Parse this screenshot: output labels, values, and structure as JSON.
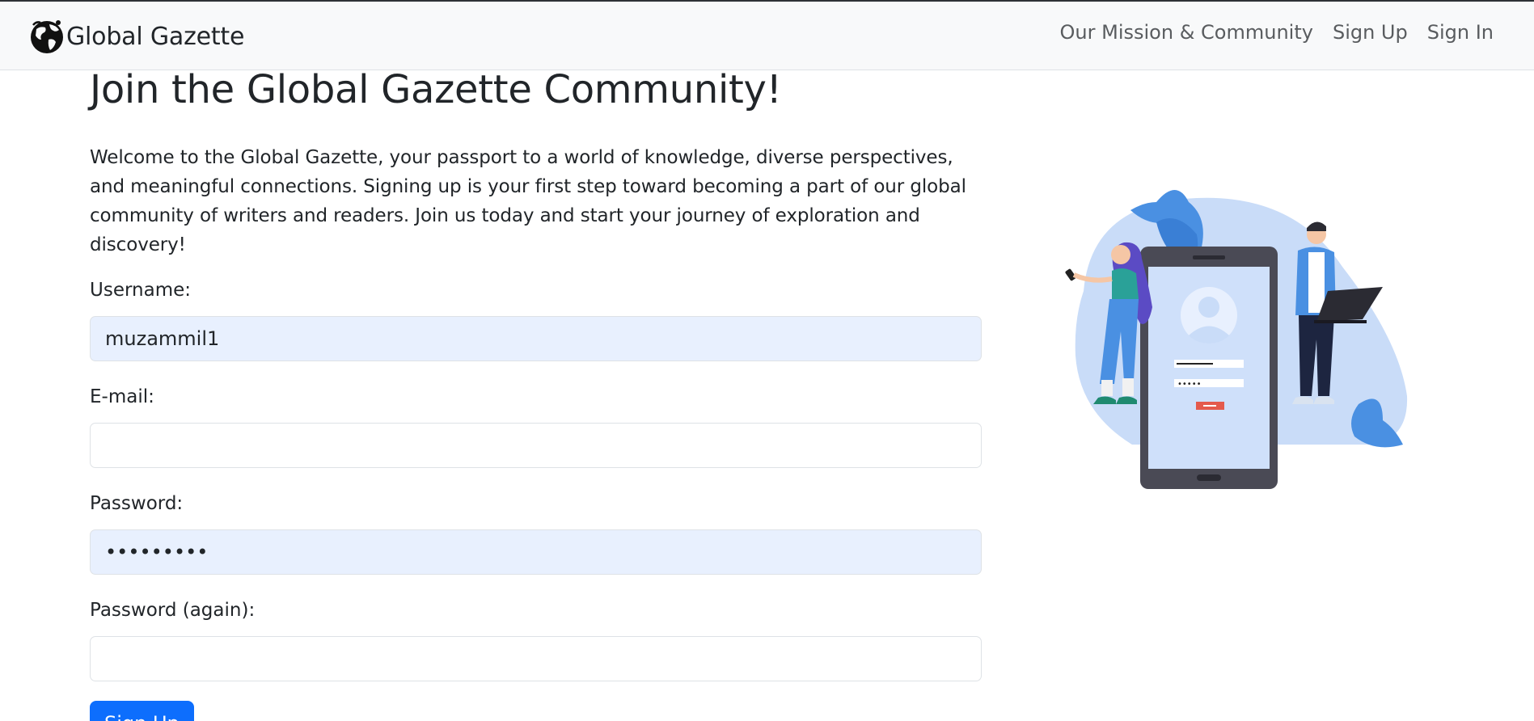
{
  "navbar": {
    "brand": "Global Gazette",
    "links": [
      {
        "label": "Our Mission & Community"
      },
      {
        "label": "Sign Up"
      },
      {
        "label": "Sign In"
      }
    ]
  },
  "page": {
    "title": "Join the Global Gazette Community!",
    "intro": "Welcome to the Global Gazette, your passport to a world of knowledge, diverse perspectives, and meaningful connections. Signing up is your first step toward becoming a part of our global community of writers and readers. Join us today and start your journey of exploration and discovery!"
  },
  "form": {
    "username": {
      "label": "Username:",
      "value": "muzammil1"
    },
    "email": {
      "label": "E-mail:",
      "value": ""
    },
    "password": {
      "label": "Password:",
      "value": "•••••••••"
    },
    "password_again": {
      "label": "Password (again):",
      "value": ""
    },
    "submit_label": "Sign Up"
  },
  "icons": {
    "brand_logo": "globe-icon"
  },
  "colors": {
    "primary": "#0d6efd",
    "autofill": "#e8f0fe",
    "navbar_bg": "#f8f9fa",
    "illustration_blue": "#4a90e2"
  }
}
